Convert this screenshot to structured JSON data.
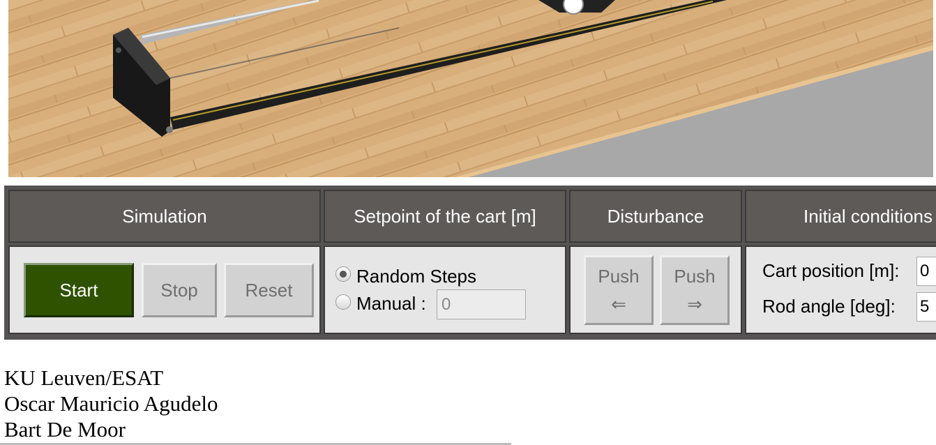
{
  "simulation": {
    "header": "Simulation",
    "start_label": "Start",
    "stop_label": "Stop",
    "reset_label": "Reset"
  },
  "setpoint": {
    "header": "Setpoint of the cart [m]",
    "random_label": "Random Steps",
    "manual_label": "Manual :",
    "manual_value": "0",
    "selected": "Random Steps"
  },
  "disturbance": {
    "header": "Disturbance",
    "push_left_label": "Push",
    "push_left_arrow": "⇐",
    "push_right_label": "Push",
    "push_right_arrow": "⇒"
  },
  "initial": {
    "header": "Initial conditions",
    "cart_position_label": "Cart position [m]:",
    "cart_position_value": "0",
    "rod_angle_label": "Rod angle [deg]:",
    "rod_angle_value": "5"
  },
  "credits": {
    "line1": "KU Leuven/ESAT",
    "line2": "Oscar Mauricio Agudelo",
    "line3": "Bart De Moor"
  },
  "colors": {
    "header_bg": "#5e5a58",
    "cell_bg": "#e6e6e6",
    "start_bg": "#2e5200",
    "floor_wood": "#d7ae7a",
    "scene_grey": "#a8a8a8"
  }
}
